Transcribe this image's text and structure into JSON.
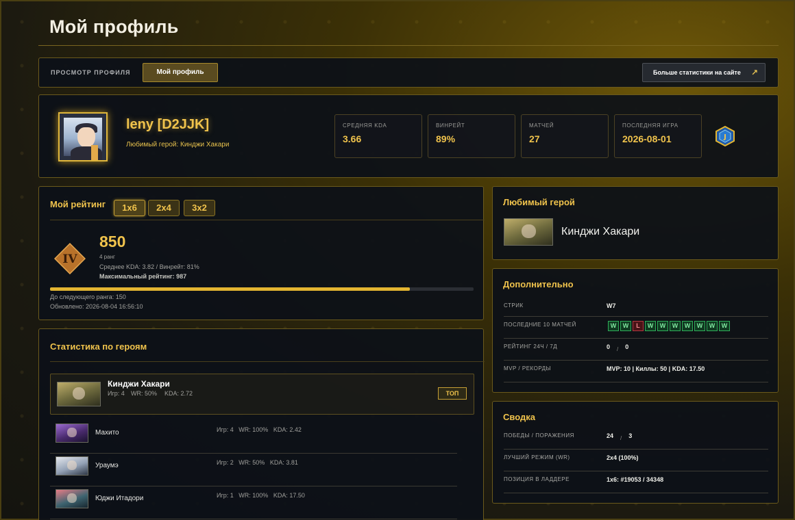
{
  "page": {
    "title": "Мой профиль"
  },
  "topbar": {
    "view_label": "ПРОСМОТР ПРОФИЛЯ",
    "my_profile_btn": "Мой профиль",
    "more_stats_btn": "Больше статистики на сайте",
    "more_stats_icon": "↗"
  },
  "profile": {
    "username": "leny [D2JJK]",
    "favorite_hero_line": "Любимый герой: Кинджи Хакари",
    "stats": [
      {
        "label": "СРЕДНЯЯ KDA",
        "value": "3.66"
      },
      {
        "label": "ВИНРЕЙТ",
        "value": "89%"
      },
      {
        "label": "МАТЧЕЙ",
        "value": "27"
      },
      {
        "label": "ПОСЛЕДНЯЯ ИГРА",
        "value": "2026-08-01"
      }
    ]
  },
  "rating": {
    "title": "Мой рейтинг",
    "modes": [
      "1x6",
      "2x4",
      "3x2"
    ],
    "active_mode": "1x6",
    "rank_numeral": "IV",
    "value": "850",
    "rank_label": "4 ранг",
    "avg_line": "Среднее KDA: 3.82 / Винрейт: 81%",
    "max_line": "Максимальный рейтинг: 987",
    "progress": 0.85,
    "next_rank": "До следующего ранга: 150",
    "updated": "Обновлено: 2026-08-04 16:56:10"
  },
  "hero_stats": {
    "title": "Статистика по героям",
    "top": {
      "name": "Кинджи Хакари",
      "games": "Игр: 4",
      "wr": "WR: 50%",
      "kda": "KDA: 2.72",
      "badge": "ТОП"
    },
    "rows": [
      {
        "name": "Махито",
        "games": "Игр: 4",
        "wr": "WR: 100%",
        "kda": "KDA: 2.42"
      },
      {
        "name": "Ураумэ",
        "games": "Игр: 2",
        "wr": "WR: 50%",
        "kda": "KDA: 3.81"
      },
      {
        "name": "Юджи Итадори",
        "games": "Игр: 1",
        "wr": "WR: 100%",
        "kda": "KDA: 17.50"
      }
    ]
  },
  "favorite": {
    "title": "Любимый герой",
    "name": "Кинджи Хакари"
  },
  "extra": {
    "title": "Дополнительно",
    "streak_label": "СТРИК",
    "streak_value": "W7",
    "last10_label": "ПОСЛЕДНИЕ 10 МАТЧЕЙ",
    "last10": [
      "W",
      "W",
      "L",
      "W",
      "W",
      "W",
      "W",
      "W",
      "W",
      "W"
    ],
    "rating_label": "РЕЙТИНГ 24Ч / 7Д",
    "rating_24h": "0",
    "rating_sep": "/",
    "rating_7d": "0",
    "mvp_label": "MVP / РЕКОРДЫ",
    "mvp_value": "MVP: 10 | Киллы: 50 | KDA: 17.50"
  },
  "summary": {
    "title": "Сводка",
    "wl_label": "ПОБЕДЫ / ПОРАЖЕНИЯ",
    "wins": "24",
    "wl_sep": "/",
    "losses": "3",
    "best_mode_label": "ЛУЧШИЙ РЕЖИМ (WR)",
    "best_mode_value": "2x4 (100%)",
    "ladder_label": "ПОЗИЦИЯ В ЛАДДЕРЕ",
    "ladder_value": "1x6: #19053 / 34348"
  },
  "colors": {
    "accent": "#f0c34c",
    "win": "#2fae5a",
    "loss": "#b33a40"
  }
}
